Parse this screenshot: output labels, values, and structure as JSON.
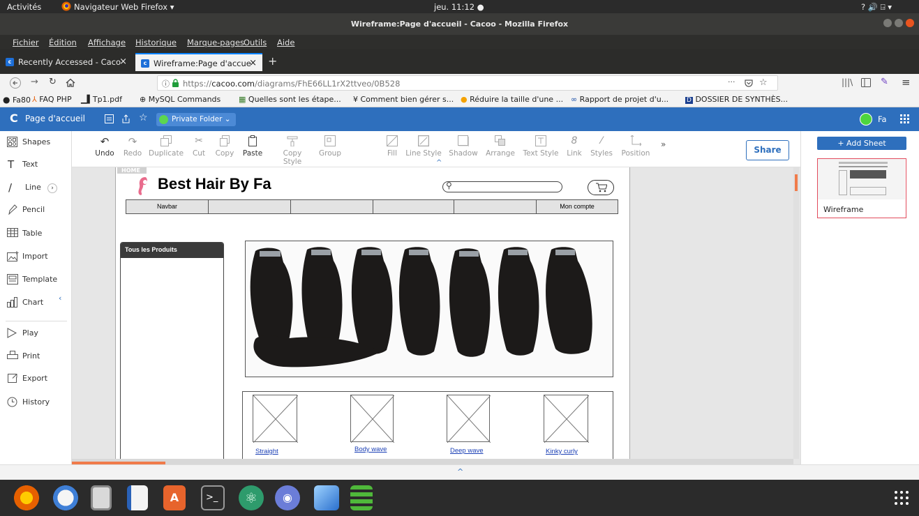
{
  "system_bar": {
    "activities": "Activités",
    "app": "Navigateur Web Firefox ▾",
    "clock": "jeu. 11:12 ●",
    "tray": "? 🔊 ⍈ ▾"
  },
  "window": {
    "title": "Wireframe:Page d'accueil - Cacoo - Mozilla Firefox"
  },
  "menu": [
    "Fichier",
    "Édition",
    "Affichage",
    "Historique",
    "Marque-pages",
    "Outils",
    "Aide"
  ],
  "tabs": [
    {
      "label": "Recently Accessed - Caco",
      "active": false
    },
    {
      "label": "Wireframe:Page d'accue",
      "active": true
    }
  ],
  "url": {
    "prefix": "https://",
    "domain": "cacoo.com",
    "path": "/diagrams/FhE66LL1rX2ttveo/0B528",
    "dots": "···"
  },
  "bookmarks": [
    "Fa80",
    "FAQ PHP",
    "Tp1.pdf",
    "MySQL Commands",
    "Quelles sont les étape...",
    "Comment bien gérer s...",
    "Réduire la taille d'une ...",
    "Rapport de projet d'u...",
    "DOSSIER DE SYNTHÈS..."
  ],
  "cacoo_header": {
    "page_name": "Page d'accueil",
    "folder": "Private Folder ⌄",
    "user": "Fa"
  },
  "left_tools": [
    "Shapes",
    "Text",
    "Line",
    "Pencil",
    "Table",
    "Import",
    "Template",
    "Chart",
    "Play",
    "Print",
    "Export",
    "History"
  ],
  "toolbar": {
    "items": [
      {
        "label": "Undo",
        "enabled": true
      },
      {
        "label": "Redo",
        "enabled": false
      },
      {
        "label": "Duplicate",
        "enabled": false
      },
      {
        "label": "Cut",
        "enabled": false
      },
      {
        "label": "Copy",
        "enabled": false
      },
      {
        "label": "Paste",
        "enabled": true
      },
      {
        "label": "Copy Style",
        "enabled": false
      },
      {
        "label": "Group",
        "enabled": false
      },
      {
        "label": "Fill",
        "enabled": false
      },
      {
        "label": "Line Style",
        "enabled": false
      },
      {
        "label": "Shadow",
        "enabled": false
      },
      {
        "label": "Arrange",
        "enabled": false
      },
      {
        "label": "Text Style",
        "enabled": false
      },
      {
        "label": "Link",
        "enabled": false
      },
      {
        "label": "Styles",
        "enabled": false
      },
      {
        "label": "Position",
        "enabled": false
      }
    ],
    "share": "Share",
    "more": "»"
  },
  "wireframe": {
    "home_tab": "HOME",
    "brand": "Best Hair By Fa",
    "nav_items": [
      "Navbar",
      "",
      "",
      "",
      "",
      "Mon compte"
    ],
    "sidebar_title": "Tous les Produits",
    "products": [
      "Straight",
      "Body wave",
      "Deep wave",
      "Kinky curly"
    ]
  },
  "right_panel": {
    "add_sheet": "+ Add Sheet",
    "sheet_name": "Wireframe"
  }
}
